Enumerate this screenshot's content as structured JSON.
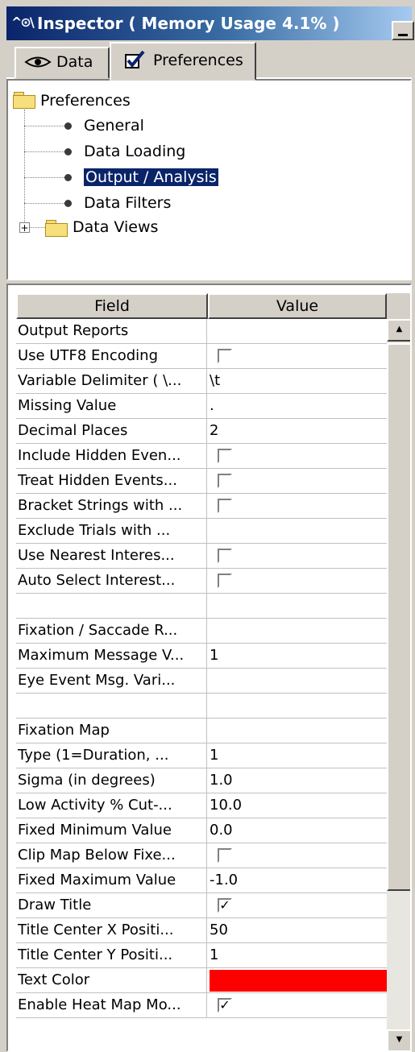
{
  "window": {
    "icon": "^⊙\\",
    "title": "Inspector ( Memory Usage 4.1% )"
  },
  "tabs": [
    {
      "label": "Data",
      "icon": "eye-icon"
    },
    {
      "label": "Preferences",
      "icon": "checkbox-icon"
    }
  ],
  "tree": {
    "root": "Preferences",
    "items": [
      "General",
      "Data Loading",
      "Output / Analysis",
      "Data Filters"
    ],
    "selected": "Output / Analysis",
    "folder": {
      "label": "Data Views",
      "expander": "+"
    }
  },
  "grid": {
    "headers": {
      "field": "Field",
      "value": "Value"
    },
    "rows": [
      {
        "field": "Output Reports",
        "value": ""
      },
      {
        "field": "Use UTF8 Encoding",
        "type": "checkbox",
        "checked": false
      },
      {
        "field": "Variable Delimiter ( \\...",
        "value": "\\t"
      },
      {
        "field": "Missing Value",
        "value": "."
      },
      {
        "field": "Decimal Places",
        "value": "2"
      },
      {
        "field": "Include Hidden Even...",
        "type": "checkbox",
        "checked": false
      },
      {
        "field": "Treat Hidden Events...",
        "type": "checkbox",
        "checked": false
      },
      {
        "field": "Bracket Strings with ...",
        "type": "checkbox",
        "checked": false
      },
      {
        "field": "Exclude Trials with ...",
        "value": ""
      },
      {
        "field": "Use Nearest Interes...",
        "type": "checkbox",
        "checked": false
      },
      {
        "field": "Auto Select Interest...",
        "type": "checkbox",
        "checked": false
      },
      {
        "field": "",
        "value": ""
      },
      {
        "field": "Fixation / Saccade R...",
        "value": ""
      },
      {
        "field": "Maximum Message V...",
        "value": "1"
      },
      {
        "field": "Eye Event Msg. Vari...",
        "value": ""
      },
      {
        "field": "",
        "value": ""
      },
      {
        "field": "Fixation Map",
        "value": ""
      },
      {
        "field": "Type (1=Duration, ...",
        "value": "1"
      },
      {
        "field": "Sigma (in degrees)",
        "value": "1.0"
      },
      {
        "field": "Low Activity % Cut-...",
        "value": "10.0"
      },
      {
        "field": "Fixed Minimum Value",
        "value": "0.0"
      },
      {
        "field": "Clip Map Below Fixe...",
        "type": "checkbox",
        "checked": false
      },
      {
        "field": "Fixed Maximum Value",
        "value": "-1.0"
      },
      {
        "field": "Draw Title",
        "type": "checkbox",
        "checked": true
      },
      {
        "field": "Title Center X Positi...",
        "value": "50"
      },
      {
        "field": "Title Center Y Positi...",
        "value": "1"
      },
      {
        "field": "Text Color",
        "type": "color",
        "color": "#ff0000"
      },
      {
        "field": "Enable Heat Map Mo...",
        "type": "checkbox",
        "checked": true
      }
    ]
  },
  "scrollbar": {
    "up": "▲",
    "down": "▼"
  },
  "colors": {
    "title_start": "#0a246a",
    "title_end": "#a6caf0",
    "selection": "#0a246a",
    "text_color": "#ff0000"
  }
}
